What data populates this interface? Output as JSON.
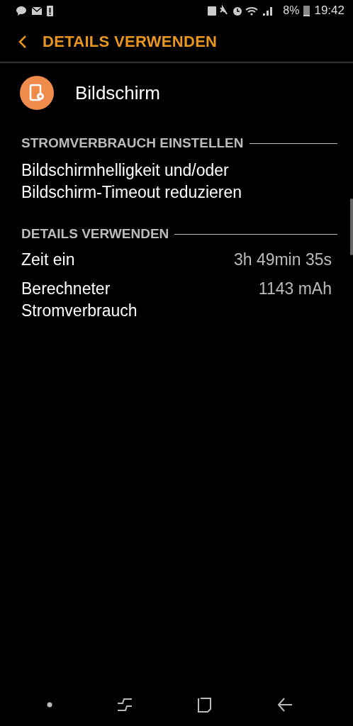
{
  "status_bar": {
    "battery": "8%",
    "time": "19:42"
  },
  "header": {
    "title": "DETAILS VERWENDEN"
  },
  "app": {
    "name": "Bildschirm"
  },
  "sections": [
    {
      "title": "STROMVERBRAUCH EINSTELLEN",
      "text": "Bildschirmhelligkeit und/oder Bildschirm-Timeout reduzieren"
    },
    {
      "title": "DETAILS VERWENDEN",
      "rows": [
        {
          "label": "Zeit ein",
          "value": "3h 49min 35s"
        },
        {
          "label": "Berechneter Stromverbrauch",
          "value": "1143 mAh"
        }
      ]
    }
  ]
}
